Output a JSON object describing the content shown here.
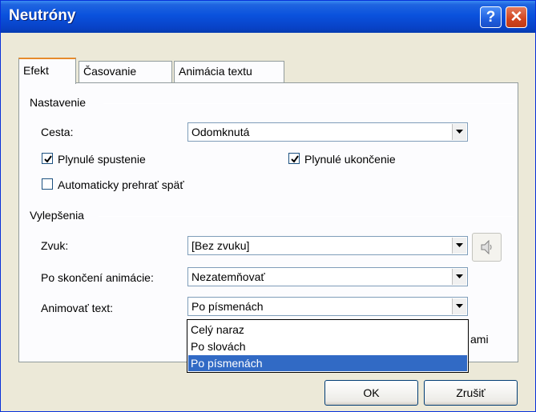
{
  "window": {
    "title": "Neutróny"
  },
  "titlebar": {
    "help_glyph": "?",
    "close_glyph": "✕"
  },
  "tabs": [
    {
      "label": "Efekt",
      "active": true
    },
    {
      "label": "Časovanie",
      "active": false
    },
    {
      "label": "Animácia textu",
      "active": false
    }
  ],
  "settings": {
    "group_label": "Nastavenie",
    "path_label": "Cesta:",
    "path_value": "Odomknutá",
    "smooth_start": {
      "label": "Plynulé spustenie",
      "checked": true
    },
    "smooth_end": {
      "label": "Plynulé ukončenie",
      "checked": true
    },
    "auto_reverse": {
      "label": "Automaticky prehrať späť",
      "checked": false
    }
  },
  "enhancements": {
    "group_label": "Vylepšenia",
    "sound_label": "Zvuk:",
    "sound_value": "[Bez zvuku]",
    "after_label": "Po skončení animácie:",
    "after_value": "Nezatemňovať",
    "animate_label": "Animovať text:",
    "animate_value": "Po písmenách",
    "animate_options": [
      "Celý naraz",
      "Po slovách",
      "Po písmenách"
    ],
    "hidden_trail_text": "ami"
  },
  "buttons": {
    "ok": "OK",
    "cancel": "Zrušiť"
  },
  "colors": {
    "titlebar": "#0a52dd",
    "selection": "#316ac5",
    "tab_accent": "#e68b2c"
  }
}
